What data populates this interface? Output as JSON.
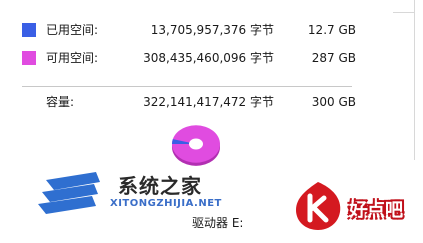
{
  "used": {
    "label": "已用空间:",
    "bytes": "13,705,957,376 字节",
    "size": "12.7 GB",
    "color": "#3a5fe5",
    "fraction": 0.0423
  },
  "free": {
    "label": "可用空间:",
    "bytes": "308,435,460,096 字节",
    "size": "287 GB",
    "color": "#e04ce0"
  },
  "capacity": {
    "label": "容量:",
    "bytes": "322,141,417,472 字节",
    "size": "300 GB"
  },
  "drive": {
    "label": "驱动器 E:"
  },
  "watermarks": {
    "left_cn": "系统之家",
    "left_en": "XITONGZHIJIA.NET",
    "right_text": "好点吧"
  }
}
